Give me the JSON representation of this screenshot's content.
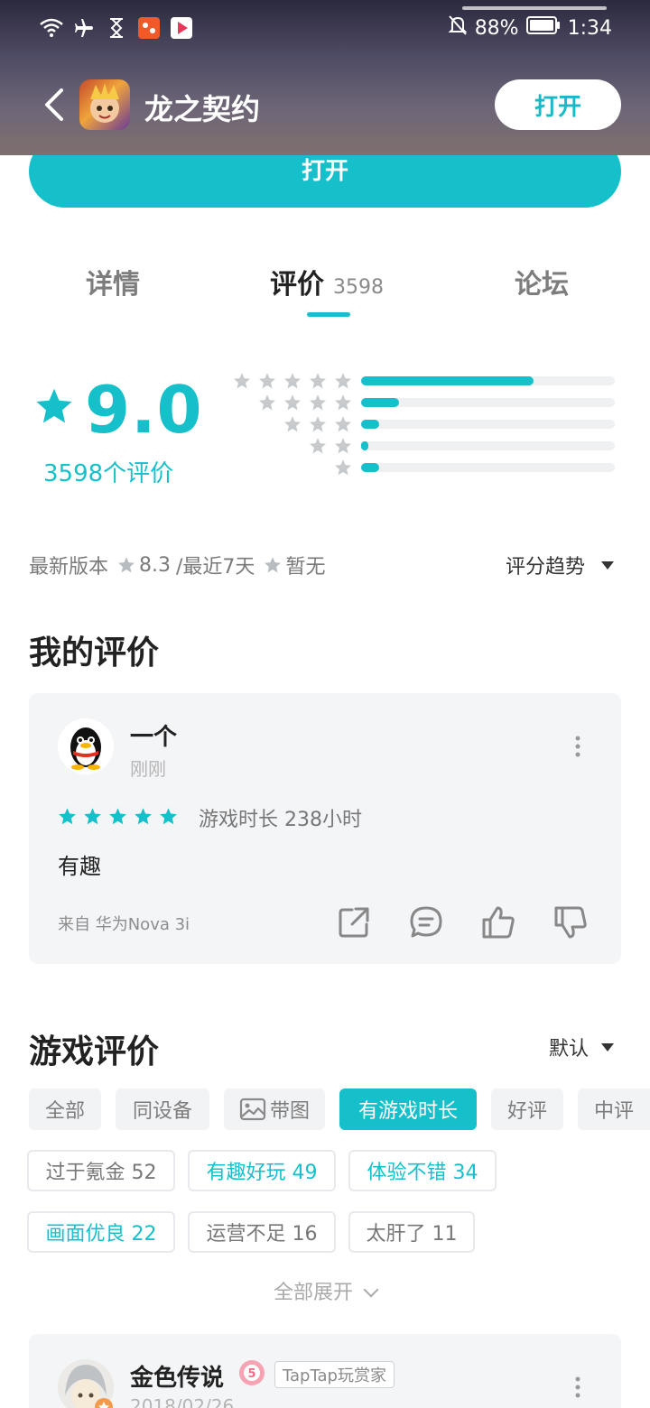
{
  "status_bar": {
    "battery": "88%",
    "time": "1:34",
    "icons": [
      "wifi-icon",
      "airplane-icon",
      "hourglass-icon",
      "app-icon-orange",
      "app-icon-video",
      "bell-off-icon",
      "battery-icon"
    ]
  },
  "nav": {
    "title": "龙之契约",
    "open_label": "打开",
    "back_icon": "chevron-left-icon"
  },
  "main_open_label": "打开",
  "tabs": [
    {
      "label": "详情",
      "count": ""
    },
    {
      "label": "评价",
      "count": "3598"
    },
    {
      "label": "论坛",
      "count": ""
    }
  ],
  "rating": {
    "score": "9.0",
    "count_text": "3598个评价",
    "distribution": [
      {
        "stars": 5,
        "fraction": 0.68
      },
      {
        "stars": 4,
        "fraction": 0.15
      },
      {
        "stars": 3,
        "fraction": 0.07
      },
      {
        "stars": 2,
        "fraction": 0.03
      },
      {
        "stars": 1,
        "fraction": 0.07
      }
    ],
    "latest_version_label": "最新版本",
    "latest_version_score": "8.3",
    "recent_label": "/最近7天",
    "recent_score": "暂无",
    "trend_label": "评分趋势"
  },
  "my_review": {
    "section_title": "我的评价",
    "user_name": "一个",
    "time": "刚刚",
    "stars": 5,
    "playtime": "游戏时长 238小时",
    "text": "有趣",
    "device": "来自 华为Nova 3i"
  },
  "game_reviews": {
    "section_title": "游戏评价",
    "sort_label": "默认",
    "filters": [
      {
        "label": "全部",
        "active": false
      },
      {
        "label": "同设备",
        "active": false
      },
      {
        "label": "带图",
        "active": false
      },
      {
        "label": "有游戏时长",
        "active": true
      },
      {
        "label": "好评",
        "active": false
      },
      {
        "label": "中评",
        "active": false
      }
    ],
    "tags": [
      {
        "label": "过于氪金 52",
        "positive": false
      },
      {
        "label": "有趣好玩 49",
        "positive": true
      },
      {
        "label": "体验不错 34",
        "positive": true
      },
      {
        "label": "画面优良 22",
        "positive": true
      },
      {
        "label": "运营不足 16",
        "positive": false
      },
      {
        "label": "太肝了 11",
        "positive": false
      }
    ],
    "expand_label": "全部展开",
    "first_review": {
      "user_name": "金色传说",
      "badge": "TapTap玩赏家",
      "date": "2018/02/26"
    }
  },
  "colors": {
    "accent": "#15c0cb",
    "header_bg": "#4d4a63",
    "card_bg": "#f4f5f7",
    "muted_text": "#7d7d7d"
  }
}
